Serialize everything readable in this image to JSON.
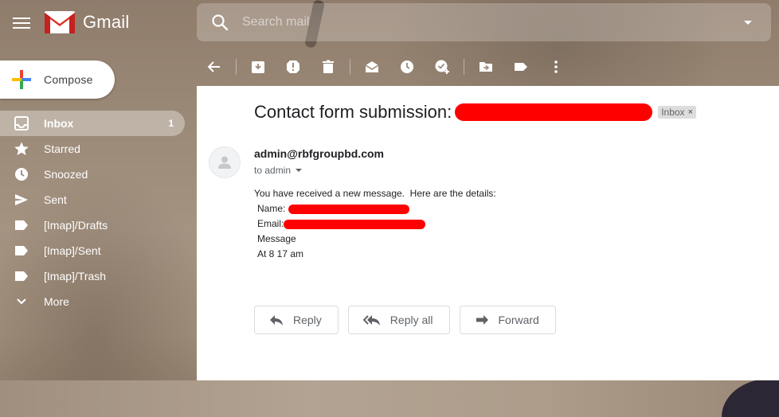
{
  "app": {
    "name": "Gmail"
  },
  "search": {
    "placeholder": "Search mail"
  },
  "compose": {
    "label": "Compose"
  },
  "sidebar": {
    "items": [
      {
        "label": "Inbox",
        "count": "1",
        "icon": "inbox-icon"
      },
      {
        "label": "Starred",
        "count": "",
        "icon": "star-icon"
      },
      {
        "label": "Snoozed",
        "count": "",
        "icon": "clock-icon"
      },
      {
        "label": "Sent",
        "count": "",
        "icon": "send-icon"
      },
      {
        "label": "[Imap]/Drafts",
        "count": "",
        "icon": "label-icon"
      },
      {
        "label": "[Imap]/Sent",
        "count": "",
        "icon": "label-icon"
      },
      {
        "label": "[Imap]/Trash",
        "count": "",
        "icon": "label-icon"
      },
      {
        "label": "More",
        "count": "",
        "icon": "chevron-down-icon"
      }
    ]
  },
  "toolbar": {
    "icons": [
      "back-arrow-icon",
      "archive-icon",
      "report-spam-icon",
      "delete-icon",
      "mark-unread-icon",
      "snooze-icon",
      "add-task-icon",
      "move-to-icon",
      "labels-icon",
      "more-vert-icon"
    ]
  },
  "message": {
    "subject": "Contact form submission:",
    "label_chip": "Inbox",
    "label_chip_close": "×",
    "sender": "admin@rbfgroupbd.com",
    "to_line": "to admin",
    "body": {
      "intro": "You have received a new message.  Here are the details:",
      "name_label": "Name: ",
      "email_label": "Email:",
      "message_label": "Message",
      "time_line": "At 8 17 am"
    }
  },
  "actions": {
    "reply": "Reply",
    "reply_all": "Reply all",
    "forward": "Forward"
  },
  "colors": {
    "redaction": "#ff0000",
    "panel_bg": "#ffffff",
    "text_primary": "#202124"
  }
}
